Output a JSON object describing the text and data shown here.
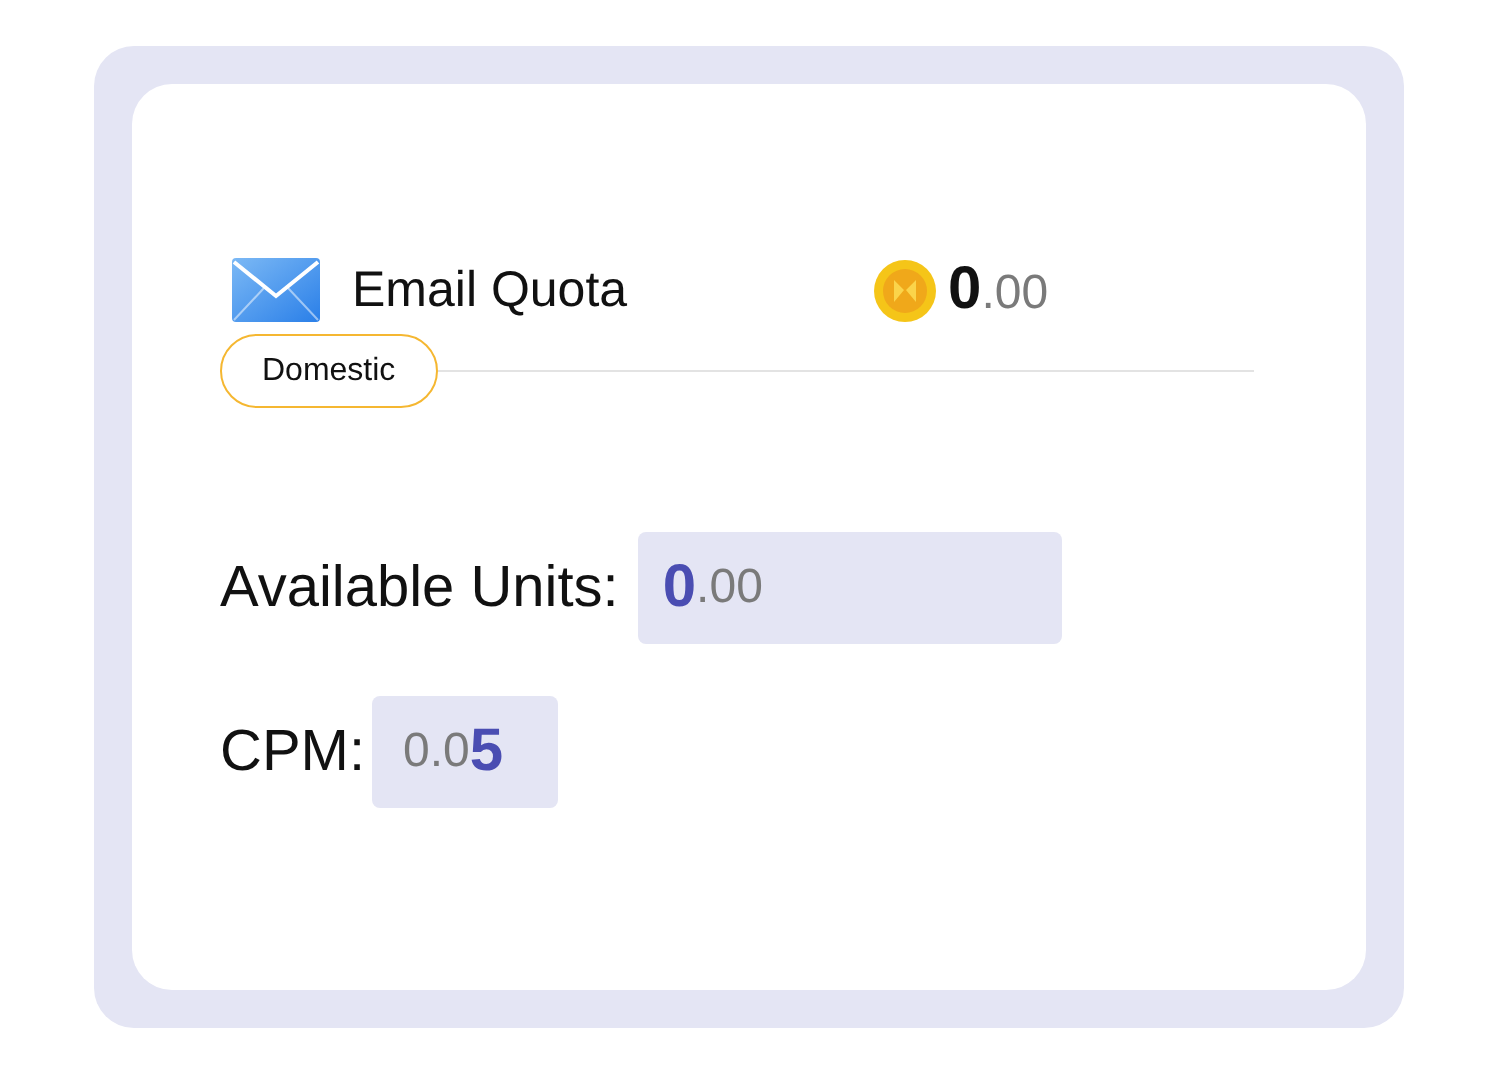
{
  "quota": {
    "title": "Email Quota",
    "balance": {
      "main": "0",
      "decimals": ".00"
    }
  },
  "region_tag": {
    "label": "Domestic"
  },
  "fields": [
    {
      "kind": "units",
      "label": "Available Units:",
      "value": {
        "main": "0",
        "decimals": ".00"
      }
    },
    {
      "kind": "cpm",
      "label": "CPM:",
      "value": {
        "prefix": "0.0",
        "emphasis": "5"
      }
    }
  ]
}
